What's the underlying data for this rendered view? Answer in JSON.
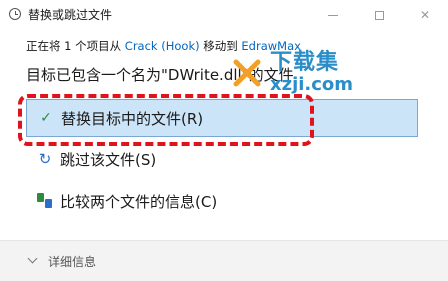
{
  "window": {
    "title": "替换或跳过文件",
    "icons": [
      "clock-icon",
      "minimize-icon",
      "maximize-icon",
      "close-icon"
    ]
  },
  "info": {
    "prefix": "正在将 1 个项目从 ",
    "source": "Crack (Hook)",
    "middle": " 移动到 ",
    "destination": "EdrawMax"
  },
  "headline": "目标已包含一个名为\"DWrite.dll\"的文件",
  "options": [
    {
      "label": "替换目标中的文件(R)",
      "icon": "check-icon",
      "selected": true
    },
    {
      "label": "跳过该文件(S)",
      "icon": "skip-icon"
    },
    {
      "label": "比较两个文件的信息(C)",
      "icon": "compare-icon"
    }
  ],
  "footer": {
    "details_label": "详细信息"
  },
  "watermark": {
    "line1": "下载集",
    "line2": "xzji.com"
  },
  "colors": {
    "selected_bg": "#cce4f7",
    "link": "#0067c0",
    "highlight": "#e0121b"
  }
}
